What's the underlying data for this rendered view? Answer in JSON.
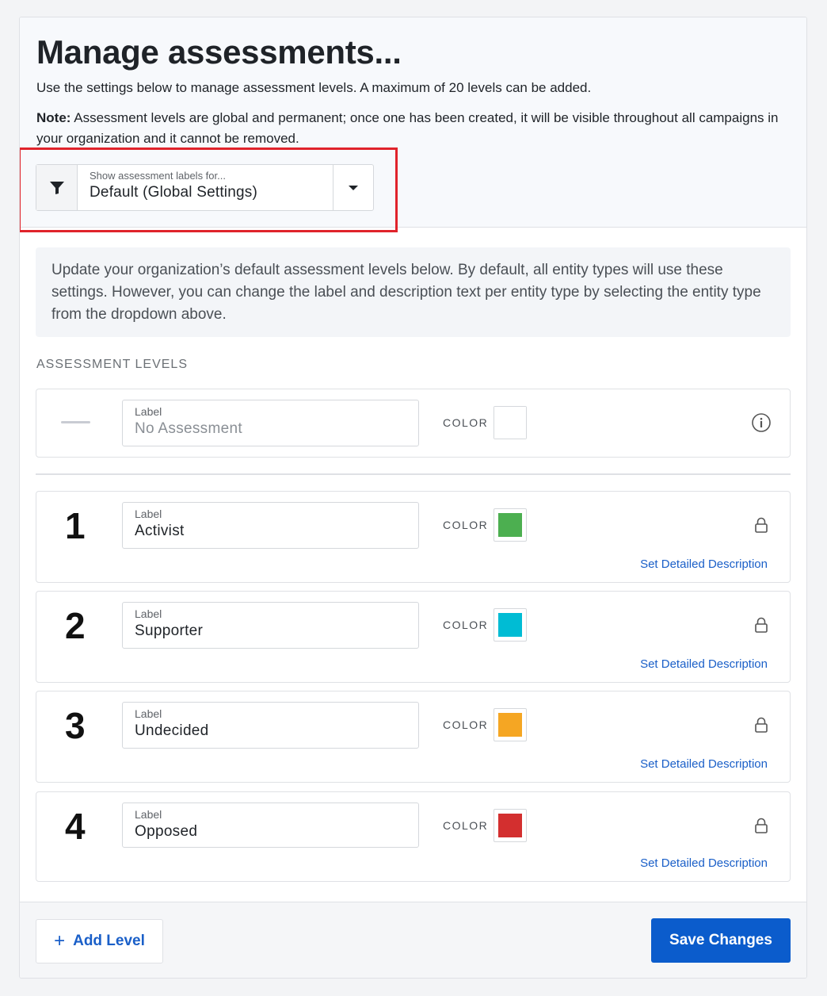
{
  "header": {
    "title": "Manage assessments...",
    "intro": "Use the settings below to manage assessment levels. A maximum of 20 levels can be added.",
    "note_label": "Note:",
    "note_text": " Assessment levels are global and permanent; once one has been created, it will be visible throughout all campaigns in your organization and it cannot be removed."
  },
  "filter": {
    "icon": "filter-icon",
    "caption": "Show assessment labels for...",
    "value": "Default (Global Settings)",
    "caret_icon": "caret-down-icon",
    "highlight_color": "#e0232b"
  },
  "info": {
    "text": "Update your organization’s default assessment levels below. By default, all entity types will use these settings. However, you can change the label and description text per entity type by selecting the entity type from the dropdown above."
  },
  "section_label": "ASSESSMENT LEVELS",
  "no_assessment": {
    "field_caption": "Label",
    "value": "No Assessment",
    "color_caption": "COLOR",
    "color": "#ffffff",
    "icon": "info-icon"
  },
  "levels": [
    {
      "number": "1",
      "field_caption": "Label",
      "value": "Activist",
      "color_caption": "COLOR",
      "color": "#4caf50",
      "icon": "lock-icon",
      "link": "Set Detailed Description"
    },
    {
      "number": "2",
      "field_caption": "Label",
      "value": "Supporter",
      "color_caption": "COLOR",
      "color": "#00bcd4",
      "icon": "lock-icon",
      "link": "Set Detailed Description"
    },
    {
      "number": "3",
      "field_caption": "Label",
      "value": "Undecided",
      "color_caption": "COLOR",
      "color": "#f5a623",
      "icon": "lock-icon",
      "link": "Set Detailed Description"
    },
    {
      "number": "4",
      "field_caption": "Label",
      "value": "Opposed",
      "color_caption": "COLOR",
      "color": "#d32f2f",
      "icon": "lock-icon",
      "link": "Set Detailed Description"
    }
  ],
  "footer": {
    "add_label": "Add Level",
    "add_icon": "plus-icon",
    "save_label": "Save Changes"
  }
}
